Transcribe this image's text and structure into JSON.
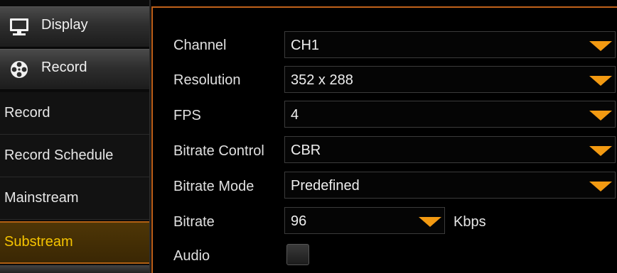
{
  "sidebar": {
    "sections": [
      {
        "label": "Display",
        "icon": "monitor-icon"
      },
      {
        "label": "Record",
        "icon": "film-reel-icon"
      }
    ],
    "items": [
      {
        "label": "Record"
      },
      {
        "label": "Record Schedule"
      },
      {
        "label": "Mainstream"
      },
      {
        "label": "Substream",
        "active": true
      }
    ]
  },
  "form": {
    "channel": {
      "label": "Channel",
      "value": "CH1"
    },
    "resolution": {
      "label": "Resolution",
      "value": "352 x 288"
    },
    "fps": {
      "label": "FPS",
      "value": "4"
    },
    "bitrate_control": {
      "label": "Bitrate Control",
      "value": "CBR"
    },
    "bitrate_mode": {
      "label": "Bitrate Mode",
      "value": "Predefined"
    },
    "bitrate": {
      "label": "Bitrate",
      "value": "96",
      "unit": "Kbps"
    },
    "audio": {
      "label": "Audio",
      "checked": false
    }
  },
  "colors": {
    "accent": "#c0611a",
    "arrow": "#f39a12",
    "active_text": "#f6c400"
  }
}
